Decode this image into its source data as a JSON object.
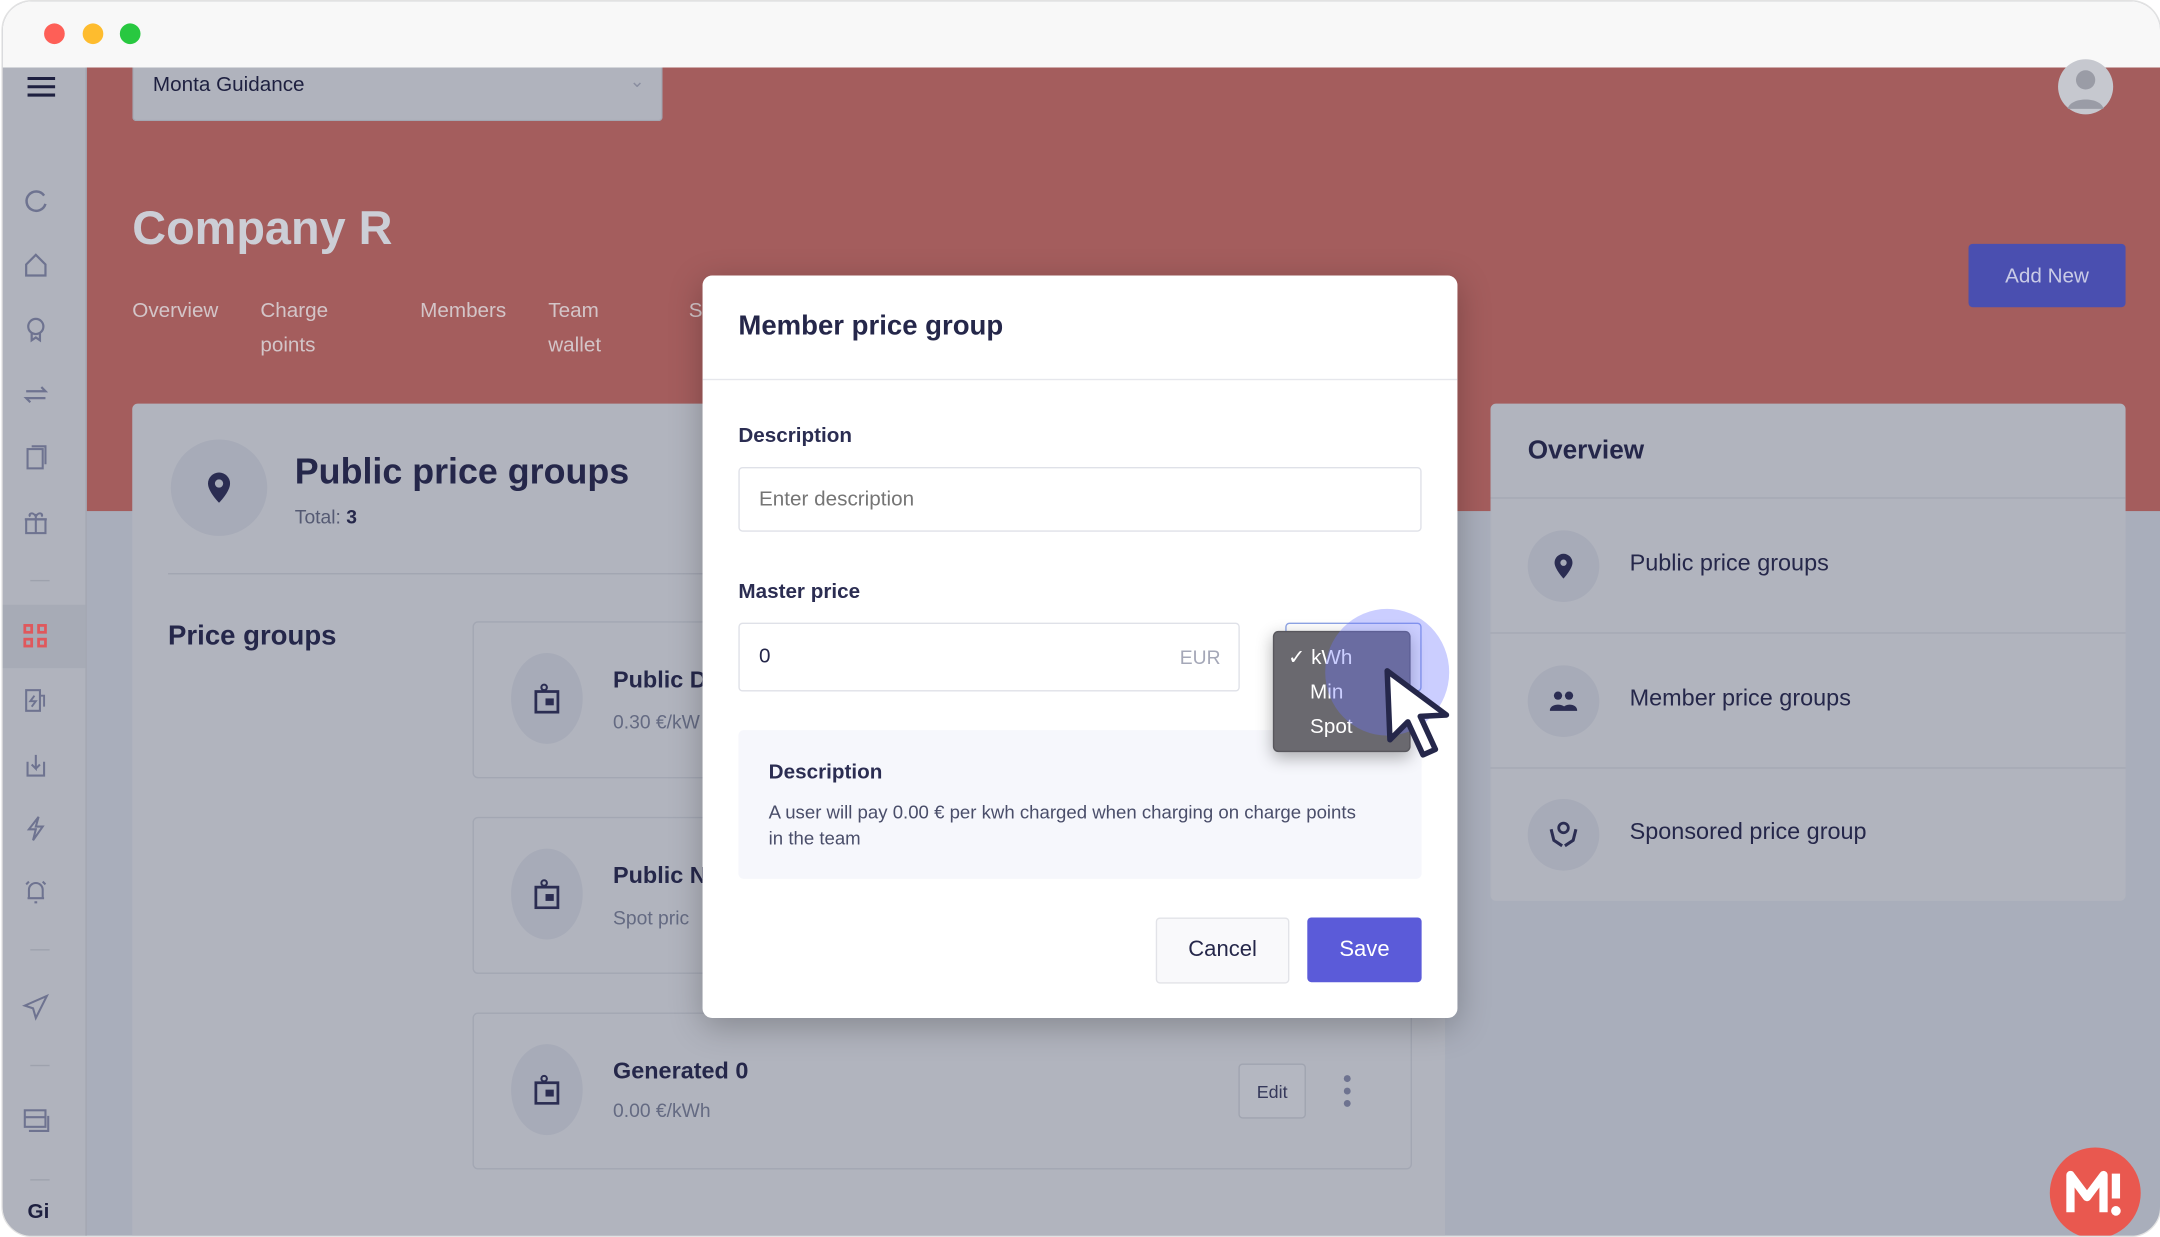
{
  "window": {
    "controls": [
      "close",
      "minimize",
      "maximize"
    ]
  },
  "org_selector": {
    "value": "Monta Guidance"
  },
  "page": {
    "title": "Company R",
    "add_new_label": "Add New",
    "tabs": [
      {
        "label": "Overview"
      },
      {
        "label": "Charge\npoints"
      },
      {
        "label": "Members"
      },
      {
        "label": "Team\nwallet"
      },
      {
        "label": "S"
      }
    ]
  },
  "sidebar": {
    "items": [
      "refresh-icon",
      "home-icon",
      "award-icon",
      "transfer-icon",
      "documents-icon",
      "gift-icon",
      "grid-icon",
      "charger-icon",
      "download-icon",
      "lightning-icon",
      "alarm-icon",
      "send-icon",
      "cards-icon"
    ],
    "active": "grid-icon",
    "footer_text": "Gi",
    "active_color": "#e0585c"
  },
  "main": {
    "title": "Public price groups",
    "total_label": "Total:",
    "total_value": "3",
    "section_title": "Price groups",
    "groups": [
      {
        "name": "Public D",
        "price": "0.30 €/kW"
      },
      {
        "name": "Public Ni",
        "price": "Spot pric"
      },
      {
        "name": "Generated 0",
        "price": "0.00 €/kWh",
        "edit_label": "Edit"
      }
    ]
  },
  "overview": {
    "title": "Overview",
    "items": [
      {
        "label": "Public price groups",
        "icon": "location-pin-icon"
      },
      {
        "label": "Member price groups",
        "icon": "users-icon"
      },
      {
        "label": "Sponsored price group",
        "icon": "hands-heart-icon"
      }
    ]
  },
  "modal": {
    "title": "Member price group",
    "description_label": "Description",
    "description_placeholder": "Enter description",
    "master_price_label": "Master price",
    "master_price_value": "0",
    "currency": "EUR",
    "unit_options": [
      "kWh",
      "Min",
      "Spot"
    ],
    "unit_selected": "kWh",
    "info_title": "Description",
    "info_text": "A user will pay 0.00 € per kwh charged when charging on charge points in the team",
    "cancel_label": "Cancel",
    "save_label": "Save"
  },
  "colors": {
    "header": "#a45d5d",
    "primary": "#5b5bd9",
    "add_new": "#4a4fb0",
    "brand_logo": "#e9584f"
  }
}
